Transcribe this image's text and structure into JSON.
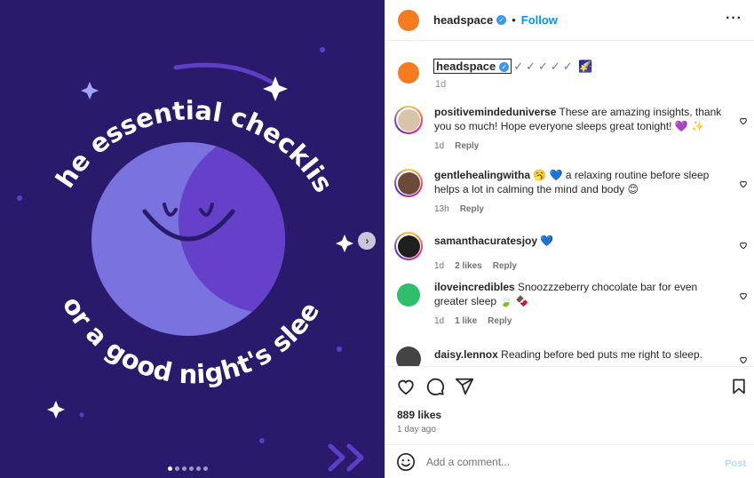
{
  "media": {
    "title_top": "The essential checklist",
    "title_bottom": "for a good night's sleep",
    "slide_count": 6,
    "active_slide": 1,
    "colors": {
      "background": "#2a1a6b",
      "moon_light": "#7a72df",
      "moon_dark": "#6541c9",
      "accent": "#5b3fc7"
    }
  },
  "header": {
    "username": "headspace",
    "separator": "•",
    "follow_label": "Follow",
    "more_icon": "more-horizontal-icon"
  },
  "caption": {
    "username": "headspace",
    "checks": "✓✓✓✓✓",
    "emoji": "🌠",
    "time": "1d"
  },
  "comments": [
    {
      "username": "positivemindeduniverse",
      "text": "These are amazing insights, thank you so much! Hope everyone sleeps great tonight! 💜 ✨",
      "time": "1d",
      "likes": "",
      "reply": "Reply",
      "avatar": "#d8c4a8"
    },
    {
      "username": "gentlehealingwitha",
      "text": "🥱 💙 a relaxing routine before sleep helps a lot in calming the mind and body 😊",
      "time": "13h",
      "likes": "",
      "reply": "Reply",
      "avatar": "#6b4a3a"
    },
    {
      "username": "samanthacuratesjoy",
      "text": "💙",
      "time": "1d",
      "likes": "2 likes",
      "reply": "Reply",
      "avatar": "#1f1f1f"
    },
    {
      "username": "iloveincredibles",
      "text": "Snoozzzeberry chocolate bar for even greater sleep 🍃 🍫",
      "time": "1d",
      "likes": "1 like",
      "reply": "Reply",
      "avatar": "#2fbf6a"
    },
    {
      "username": "daisy.lennox",
      "text": "Reading before bed puts me right to sleep.",
      "time": "",
      "likes": "",
      "reply": "",
      "avatar": "#444444"
    }
  ],
  "actions": {
    "likes": "889 likes",
    "time_ago": "1 day ago"
  },
  "add_comment": {
    "placeholder": "Add a comment...",
    "post_label": "Post"
  }
}
